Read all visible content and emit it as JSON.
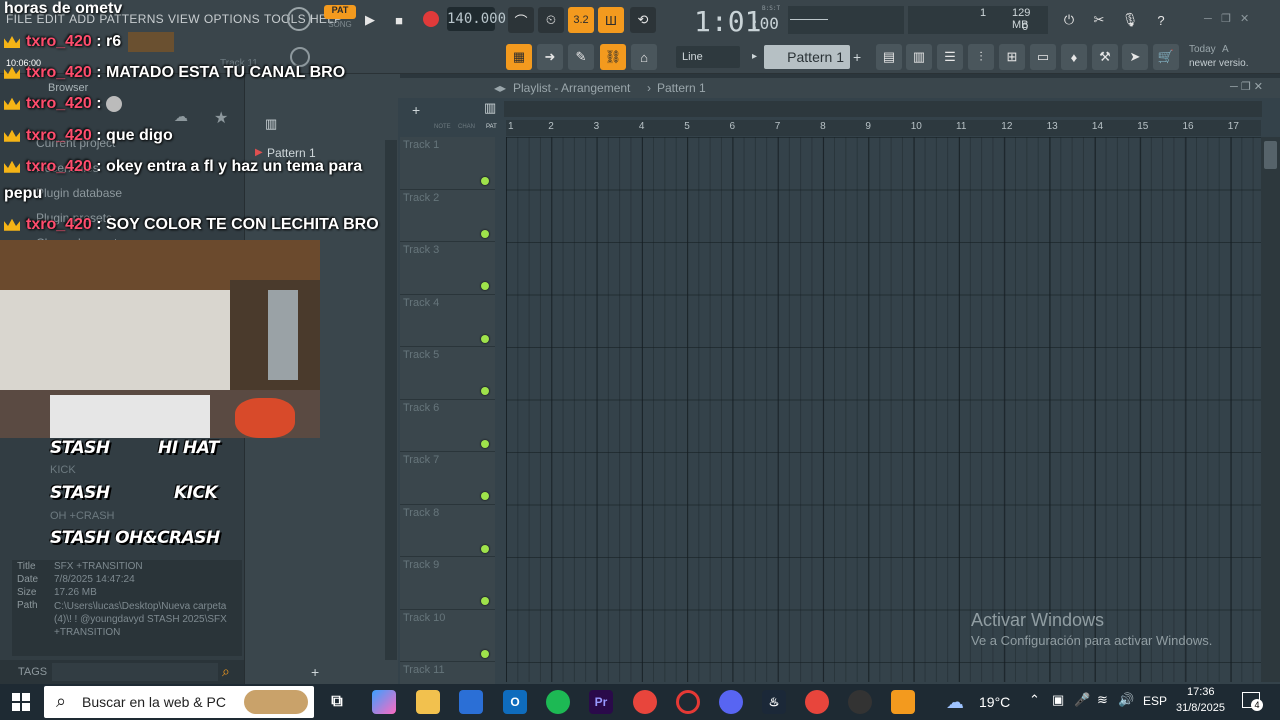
{
  "stream": {
    "title": "horas de ometv",
    "chat": [
      {
        "user": "txro_420",
        "msg": ": r6"
      },
      {
        "user": "txro_420",
        "msg": ": MATADO ESTA TU CANAL BRO"
      },
      {
        "user": "txro_420",
        "msg": ":"
      },
      {
        "user": "txro_420",
        "msg": ": que digo"
      },
      {
        "user": "txro_420",
        "msg": ": okey entra a fl y haz un tema para"
      },
      {
        "user": "",
        "msg": "pepu"
      },
      {
        "user": "txro_420",
        "msg": ": SOY COLOR TE CON LECHITA BRO"
      }
    ],
    "stash_labels": [
      "STASH",
      "HI HAT",
      "STASH",
      "KICK",
      "STASH OH&CRASH"
    ]
  },
  "fl": {
    "menu": [
      "FILE",
      "EDIT",
      "ADD",
      "PATTERNS",
      "VIEW",
      "OPTIONS",
      "TOOLS",
      "HELP"
    ],
    "pat_label": "PAT",
    "song_label": "SONG",
    "tempo": "140.000",
    "time": "1:01",
    "time_sub": ":00",
    "bst": "B:S:T",
    "mem": "129 MB",
    "cpu_top": "1",
    "cpu_bottom": "0",
    "clock_small": "10:06:00",
    "snap": "Line",
    "pattern": "Pattern 1",
    "news_title": "Today",
    "news_a": "A",
    "news_text": "newer versio.",
    "track_ghost": "Track 11"
  },
  "browser": {
    "label": "Browser",
    "items": [
      "Current project",
      "Recent files",
      "Plugin database",
      "Plugin presets",
      "Channel presets"
    ],
    "ghost_items": [
      "KICK",
      "OH +CRASH"
    ],
    "info": {
      "title_k": "Title",
      "title_v": "SFX +TRANSITION",
      "date_k": "Date",
      "date_v": "7/8/2025 14:47:24",
      "size_k": "Size",
      "size_v": "17.26 MB",
      "path_k": "Path",
      "path_v": "C:\\Users\\lucas\\Desktop\\Nueva carpeta (4)\\! ! @youngdavyd STASH 2025\\SFX +TRANSITION"
    },
    "tags": "TAGS"
  },
  "channel": {
    "pattern": "Pattern 1",
    "add": "+"
  },
  "playlist": {
    "title": "Playlist - Arrangement",
    "sep": "›",
    "pattern": "Pattern 1",
    "col_note": "NOTE",
    "col_chan": "CHAN",
    "col_pat": "PAT",
    "ruler": [
      "1",
      "2",
      "3",
      "4",
      "5",
      "6",
      "7",
      "8",
      "9",
      "10",
      "11",
      "12",
      "13",
      "14",
      "15",
      "16",
      "17"
    ],
    "tracks": [
      "Track 1",
      "Track 2",
      "Track 3",
      "Track 4",
      "Track 5",
      "Track 6",
      "Track 7",
      "Track 8",
      "Track 9",
      "Track 10",
      "Track 11"
    ]
  },
  "watermark": {
    "title": "Activar Windows",
    "sub": "Ve a Configuración para activar Windows."
  },
  "taskbar": {
    "search": "Buscar en la web & PC",
    "weather": "19°C",
    "lang": "ESP",
    "time": "17:36",
    "date": "31/8/2025",
    "notif": "4"
  },
  "colors": {
    "accent": "#f39a1e",
    "track_dot": "#9fe34b",
    "chat_user": "#ff4d6d"
  }
}
